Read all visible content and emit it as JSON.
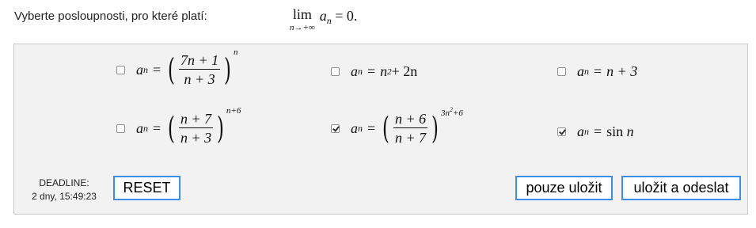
{
  "question": {
    "text": "Vyberte posloupnosti, pro které platí:",
    "lim_word": "lim",
    "lim_subscript": "n→+∞",
    "lim_body": "a",
    "lim_body_sub": "n",
    "lim_rhs": "= 0."
  },
  "options": [
    {
      "checked": false,
      "base": "a",
      "sub": "n",
      "numerator": "7n + 1",
      "denominator": "n + 3",
      "exponent": "n"
    },
    {
      "checked": false,
      "base": "a",
      "sub": "n",
      "rhs_text": "n",
      "rhs_sup": "2",
      "rhs_tail": " + 2n"
    },
    {
      "checked": false,
      "base": "a",
      "sub": "n",
      "rhs_text": "n + 3"
    },
    {
      "checked": false,
      "base": "a",
      "sub": "n",
      "numerator": "n + 7",
      "denominator": "n + 3",
      "exponent": "n+6"
    },
    {
      "checked": true,
      "base": "a",
      "sub": "n",
      "numerator": "n + 6",
      "denominator": "n + 7",
      "exponent_main": "3n",
      "exponent_sup": "2",
      "exponent_tail": "+6"
    },
    {
      "checked": true,
      "base": "a",
      "sub": "n",
      "rhs_fn": "sin",
      "rhs_text": "n"
    }
  ],
  "deadline": {
    "label": "DEADLINE:",
    "value": "2 dny, 15:49:23"
  },
  "buttons": {
    "reset": "RESET",
    "save": "pouze uložit",
    "submit": "uložit a odeslat"
  }
}
